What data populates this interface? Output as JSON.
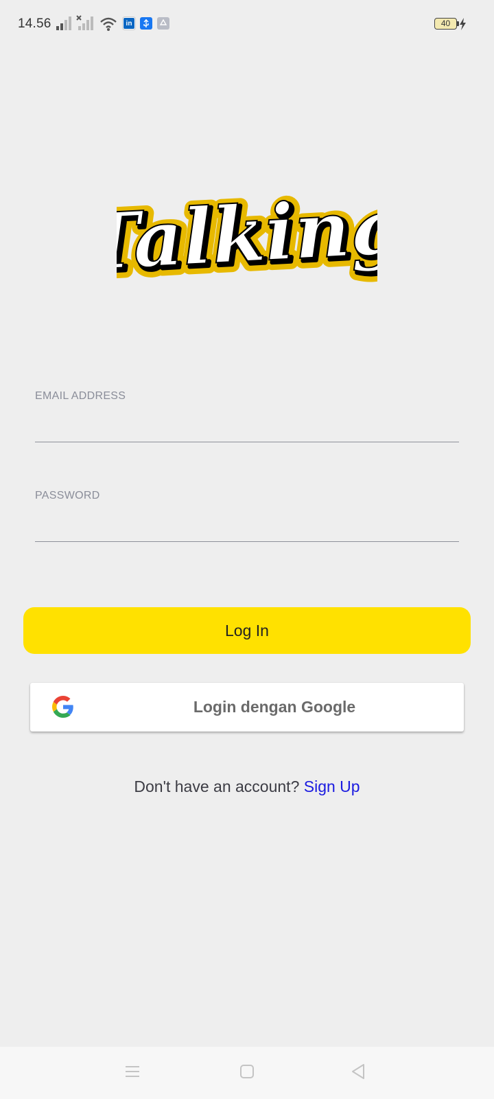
{
  "status_bar": {
    "time": "14.56",
    "battery_level": "40",
    "icons": [
      "signal-icon",
      "no-signal-icon",
      "wifi-icon",
      "linkedin-icon",
      "usb-icon",
      "recycle-icon",
      "battery-icon",
      "charging-icon"
    ]
  },
  "logo": {
    "text": "Talking"
  },
  "form": {
    "email_label": "EMAIL ADDRESS",
    "email_value": "",
    "password_label": "PASSWORD",
    "password_value": "",
    "login_button": "Log In",
    "google_button": "Login dengan Google"
  },
  "signup": {
    "prompt": "Don't have an account?",
    "link": "Sign Up"
  },
  "nav_bar": {
    "items": [
      "menu-icon",
      "home-icon",
      "back-icon"
    ]
  },
  "colors": {
    "accent": "#ffe100",
    "background": "#eeeeee",
    "link": "#1a1ae0"
  }
}
